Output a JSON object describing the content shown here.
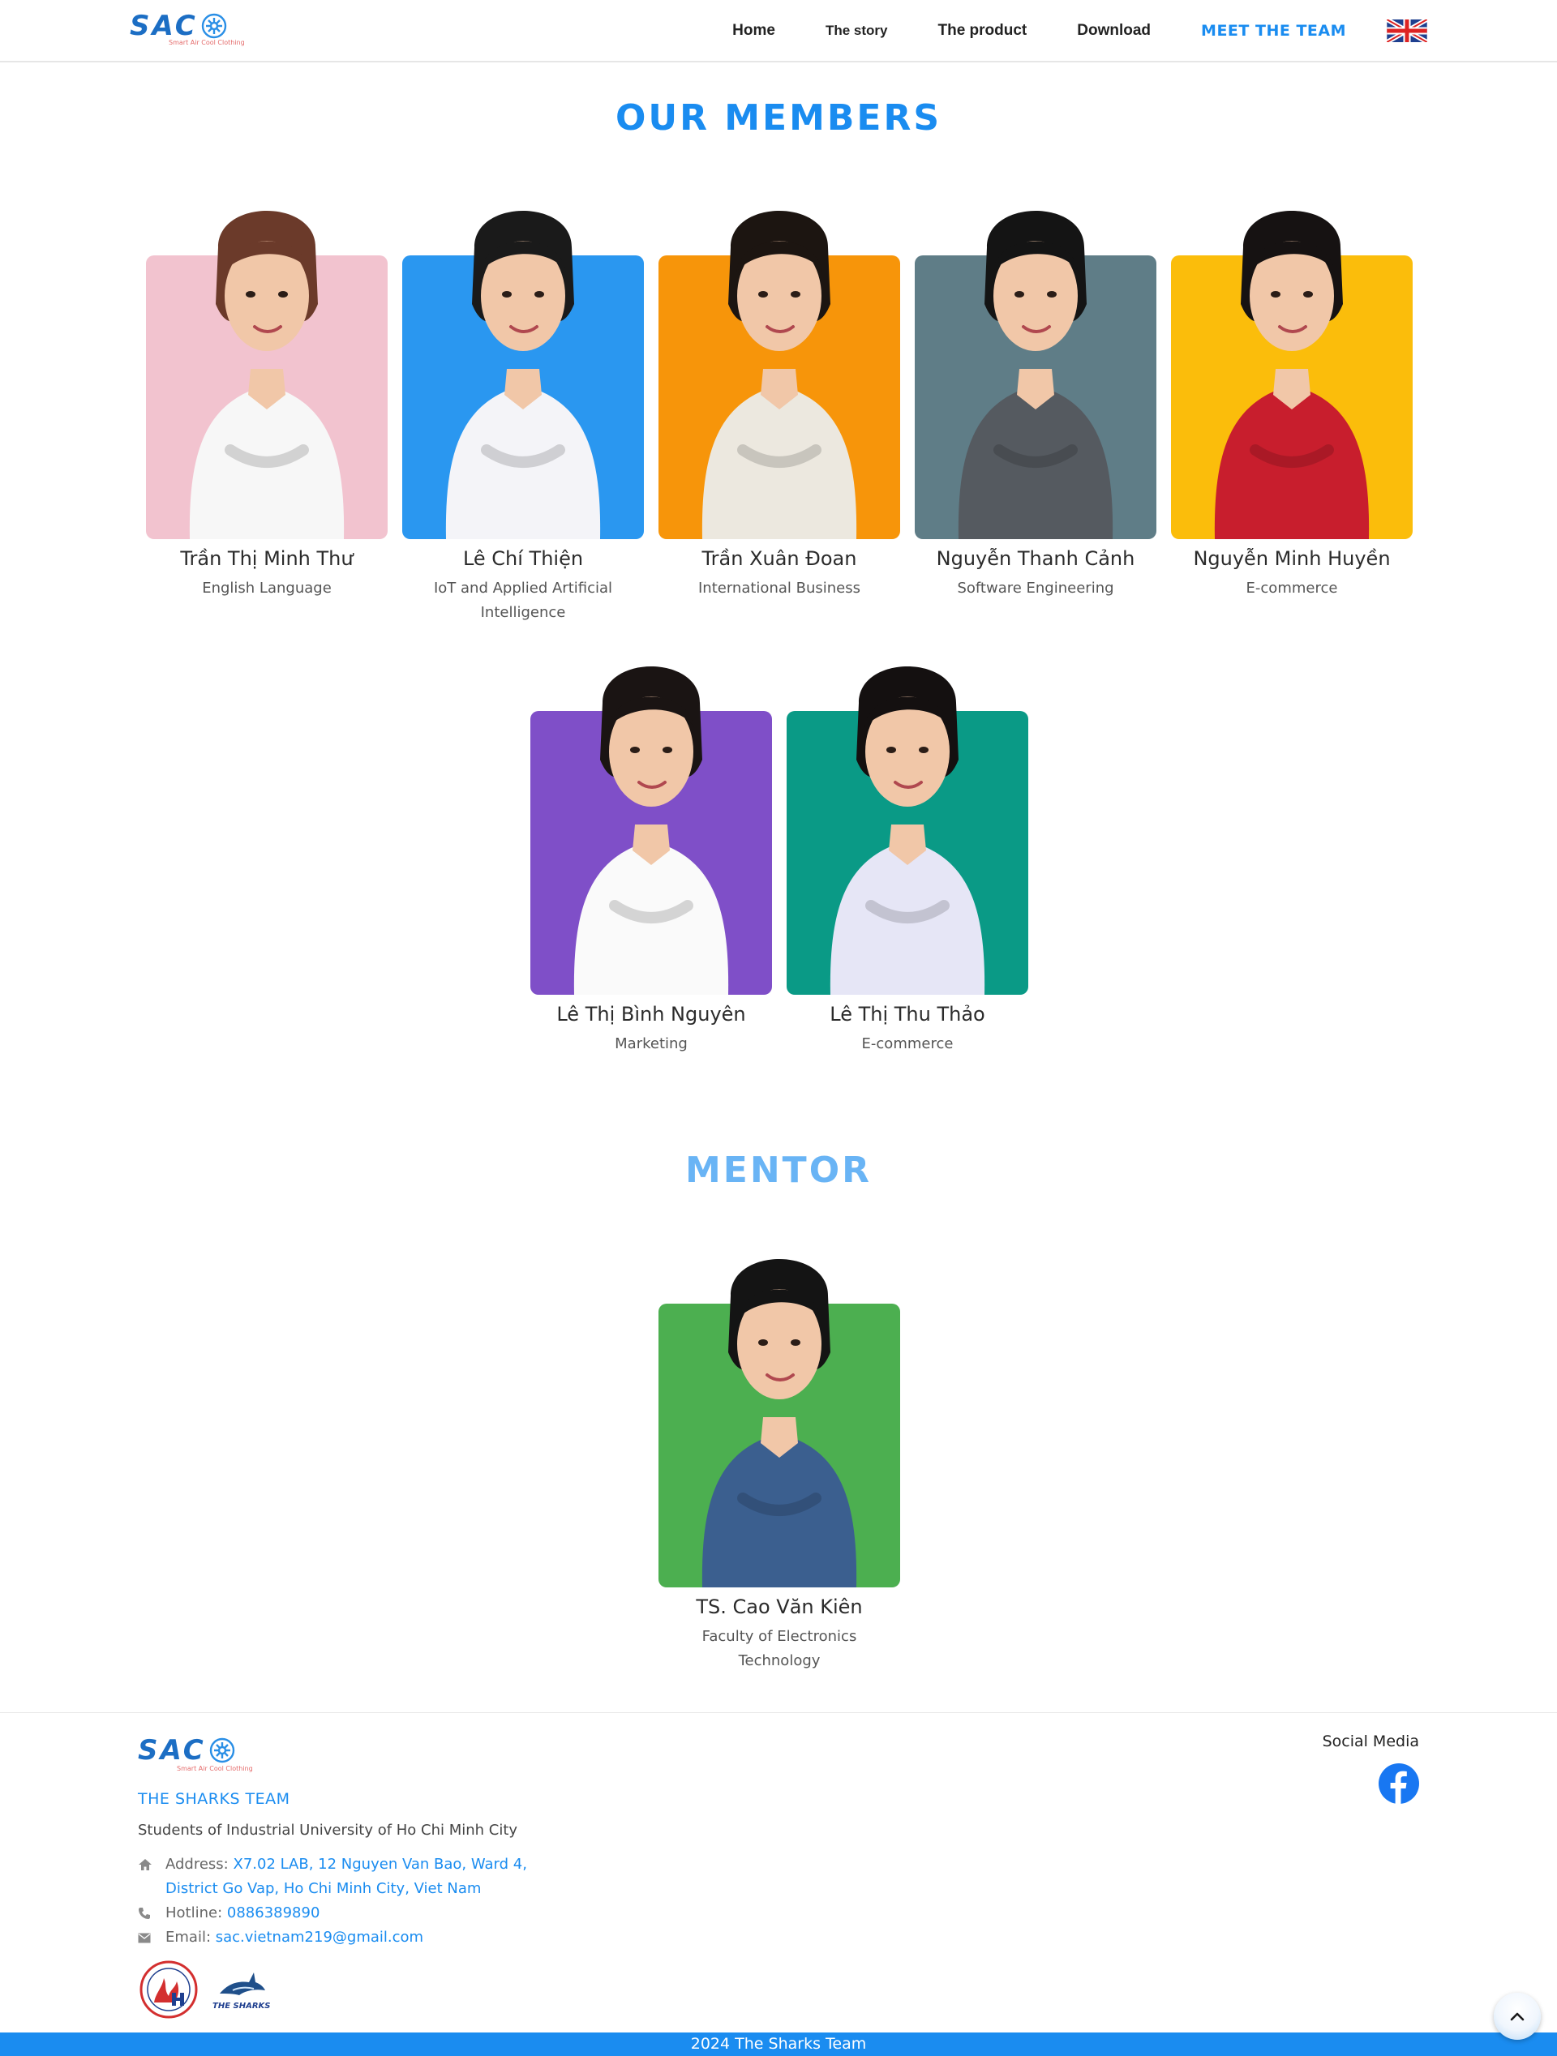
{
  "header": {
    "logo_text": "SAC",
    "logo_tagline": "Smart Air Cool Clothing",
    "nav": [
      {
        "label": "Home"
      },
      {
        "label": "The story"
      },
      {
        "label": "The product"
      },
      {
        "label": "Download"
      },
      {
        "label": "MEET THE TEAM"
      }
    ],
    "language_icon": "uk-flag-icon"
  },
  "members_section": {
    "title": "OUR MEMBERS",
    "members": [
      {
        "name": "Trần Thị Minh Thư",
        "role": "English Language",
        "color": "#f2c3cf",
        "shirt": "#f7f7f7",
        "hair": "#6b3a2a"
      },
      {
        "name": "Lê Chí Thiện",
        "role": "IoT and Applied Artificial Intelligence",
        "color": "#2a97f0",
        "shirt": "#f4f4f8",
        "hair": "#1a1a1a"
      },
      {
        "name": "Trần Xuân Đoan",
        "role": "International Business",
        "color": "#f7950a",
        "shirt": "#ece8df",
        "hair": "#1c1511"
      },
      {
        "name": "Nguyễn Thanh Cảnh",
        "role": "Software Engineering",
        "color": "#5f7d87",
        "shirt": "#555a60",
        "hair": "#141414"
      },
      {
        "name": "Nguyễn Minh Huyền",
        "role": "E-commerce",
        "color": "#fbbd0b",
        "shirt": "#c81e2d",
        "hair": "#161212"
      },
      {
        "name": "Lê Thị Bình Nguyên",
        "role": "Marketing",
        "color": "#7f4fc8",
        "shirt": "#fafafa",
        "hair": "#1a1413"
      },
      {
        "name": "Lê Thị Thu Thảo",
        "role": "E-commerce",
        "color": "#0a9a86",
        "shirt": "#e6e6f6",
        "hair": "#141010"
      }
    ]
  },
  "mentor_section": {
    "title": "MENTOR",
    "mentor": {
      "name": "TS. Cao Văn Kiên",
      "role": "Faculty of Electronics Technology",
      "color": "#4caf50",
      "shirt": "#3b5f8f",
      "hair": "#141414"
    }
  },
  "footer": {
    "logo_text": "SAC",
    "logo_tagline": "Smart Air Cool Clothing",
    "team_name": "THE SHARKS TEAM",
    "description": "Students of Industrial University of Ho Chi Minh City",
    "address_label": "Address:",
    "address_value": "X7.02 LAB, 12 Nguyen Van Bao, Ward 4, District Go Vap, Ho Chi Minh City, Viet Nam",
    "hotline_label": "Hotline:",
    "hotline_value": "0886389890",
    "email_label": "Email:",
    "email_value": "sac.vietnam219@gmail.com",
    "badge_2_text": "THE SHARKS",
    "social_title": "Social Media",
    "copyright": "2024 The Sharks Team"
  }
}
